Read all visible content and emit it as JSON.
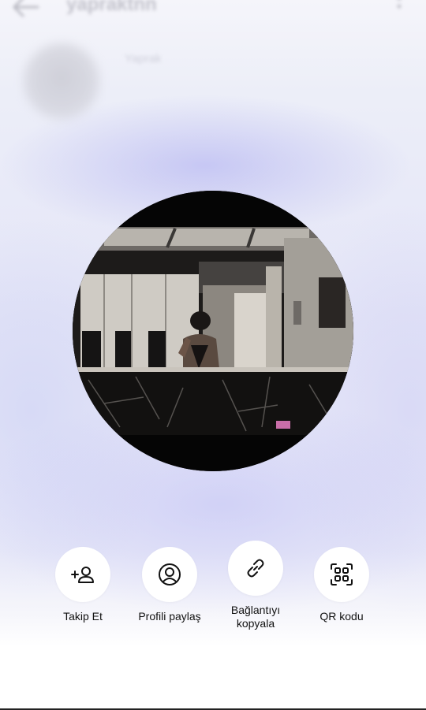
{
  "header": {
    "username": "yapraktnn",
    "display_name": "Yaprak"
  },
  "actions": [
    {
      "label": "Takip Et",
      "icon": "add-person-icon"
    },
    {
      "label": "Profili paylaş",
      "icon": "profile-circle-icon"
    },
    {
      "label": "Bağlantıyı kopyala",
      "icon": "link-icon"
    },
    {
      "label": "QR kodu",
      "icon": "qr-code-icon"
    }
  ]
}
